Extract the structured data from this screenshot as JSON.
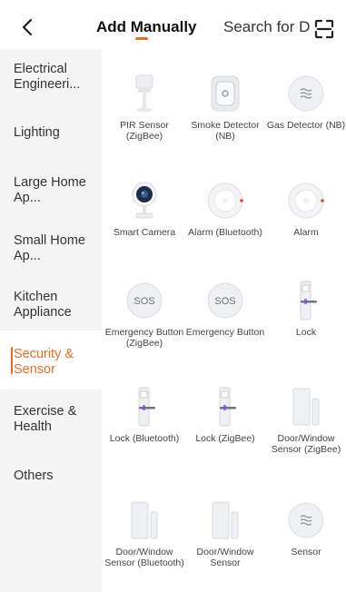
{
  "header": {
    "tab_add": "Add Manually",
    "tab_search": "Search for D",
    "accent_color": "#ee6b1f"
  },
  "sidebar": {
    "items": [
      {
        "label": "Electrical Engineeri..."
      },
      {
        "label": "Lighting"
      },
      {
        "label": "Large Home Ap..."
      },
      {
        "label": "Small Home Ap..."
      },
      {
        "label": "Kitchen Appliance"
      },
      {
        "label": "Security & Sensor",
        "active": true
      },
      {
        "label": "Exercise & Health"
      },
      {
        "label": "Others"
      }
    ]
  },
  "devices": [
    {
      "label": "PIR Sensor (ZigBee)",
      "icon": "pir-sensor-icon"
    },
    {
      "label": "Smoke Detector (NB)",
      "icon": "smoke-detector-icon"
    },
    {
      "label": "Gas Detector (NB)",
      "icon": "gas-detector-icon"
    },
    {
      "label": "Smart Camera",
      "icon": "smart-camera-icon"
    },
    {
      "label": "Alarm (Bluetooth)",
      "icon": "alarm-icon"
    },
    {
      "label": "Alarm",
      "icon": "alarm-icon"
    },
    {
      "label": "Emergency Button (ZigBee)",
      "icon": "sos-button-icon",
      "icon_text": "SOS"
    },
    {
      "label": "Emergency Button",
      "icon": "sos-button-icon",
      "icon_text": "SOS"
    },
    {
      "label": "Lock",
      "icon": "door-lock-icon"
    },
    {
      "label": "Lock (Bluetooth)",
      "icon": "door-lock-icon"
    },
    {
      "label": "Lock (ZigBee)",
      "icon": "door-lock-icon"
    },
    {
      "label": "Door/Window Sensor (ZigBee)",
      "icon": "door-window-sensor-icon"
    },
    {
      "label": "Door/Window Sensor (Bluetooth)",
      "icon": "door-window-sensor-icon"
    },
    {
      "label": "Door/Window Sensor",
      "icon": "door-window-sensor-icon"
    },
    {
      "label": "Sensor",
      "icon": "sensor-icon"
    }
  ]
}
